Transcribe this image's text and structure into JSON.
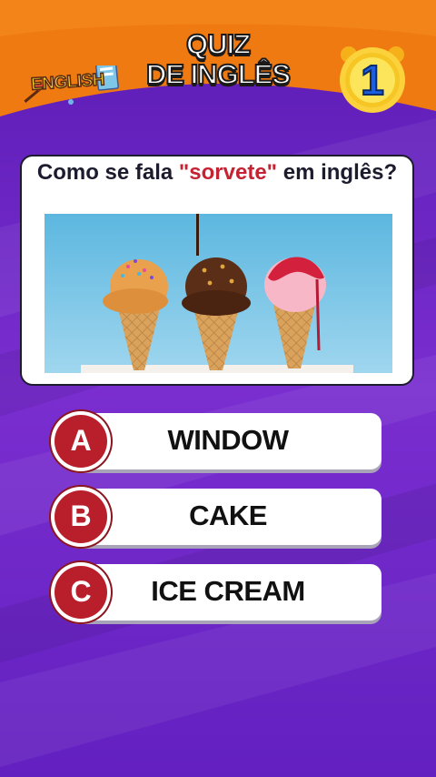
{
  "header": {
    "title_line1": "QUIZ",
    "title_line2": "DE INGLÊS",
    "badge_label": "ENGLISH",
    "question_number": "1"
  },
  "question": {
    "prefix": "Como se fala ",
    "highlight": "\"sorvete\"",
    "suffix": " em inglês?"
  },
  "image": {
    "subject": "three ice cream cones",
    "icon": "ice-cream-photo"
  },
  "answers": [
    {
      "letter": "A",
      "text": "WINDOW"
    },
    {
      "letter": "B",
      "text": "CAKE"
    },
    {
      "letter": "C",
      "text": "ICE CREAM"
    }
  ],
  "colors": {
    "header_orange": "#f07a12",
    "background_purple": "#6a22c4",
    "answer_red": "#b91f2b",
    "highlight_red": "#c42333",
    "badge_yellow": "#f6d23a",
    "number_blue": "#1b5fe0"
  }
}
